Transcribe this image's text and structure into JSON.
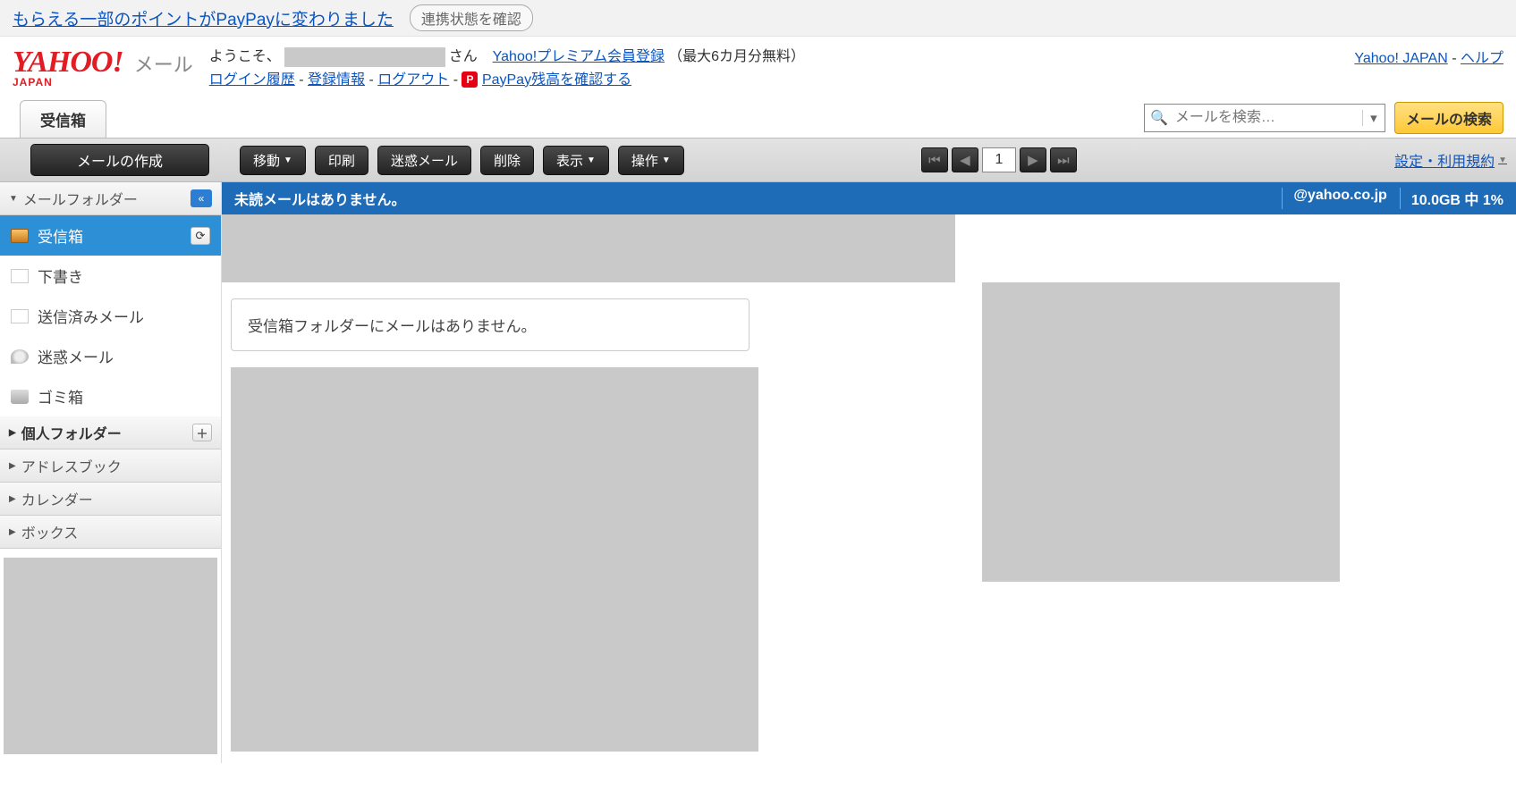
{
  "notice": {
    "link": "もらえる一部のポイントがPayPayに変わりました",
    "button": "連携状態を確認"
  },
  "logo": {
    "brand": "YAHOO!",
    "region": "JAPAN",
    "product": "メール"
  },
  "header": {
    "welcome_prefix": "ようこそ、",
    "welcome_suffix": "さん",
    "premium_link": "Yahoo!プレミアム会員登録",
    "premium_note": "（最大6カ月分無料）",
    "links": {
      "login_history": "ログイン履歴",
      "reg_info": "登録情報",
      "logout": "ログアウト",
      "paypay": "PayPay残高を確認する"
    },
    "right": {
      "japan": "Yahoo! JAPAN",
      "help": "ヘルプ"
    },
    "sep": " - "
  },
  "tab": {
    "inbox": "受信箱"
  },
  "search": {
    "placeholder": "メールを検索…",
    "button": "メールの検索"
  },
  "toolbar": {
    "compose": "メールの作成",
    "move": "移動",
    "print": "印刷",
    "spam": "迷惑メール",
    "delete": "削除",
    "view": "表示",
    "action": "操作",
    "page": "1",
    "settings": "設定・利用規約"
  },
  "sidebar": {
    "section_mail": "メールフォルダー",
    "folders": {
      "inbox": "受信箱",
      "draft": "下書き",
      "sent": "送信済みメール",
      "spam": "迷惑メール",
      "trash": "ゴミ箱"
    },
    "section_personal": "個人フォルダー",
    "section_address": "アドレスブック",
    "section_calendar": "カレンダー",
    "section_box": "ボックス"
  },
  "banner": {
    "no_unread": "未読メールはありません。",
    "domain": "@yahoo.co.jp",
    "storage": "10.0GB 中 1%"
  },
  "content": {
    "empty": "受信箱フォルダーにメールはありません。"
  }
}
